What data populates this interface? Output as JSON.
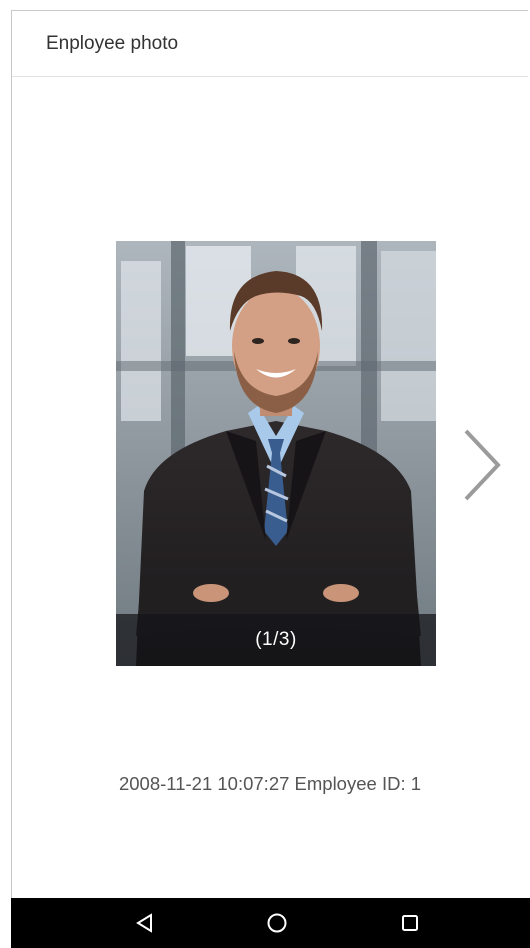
{
  "header": {
    "title": "Enployee photo"
  },
  "photo": {
    "counter": "(1/3)",
    "icon": "employee-portrait"
  },
  "navigation": {
    "next_icon": "chevron-right-icon"
  },
  "record": {
    "info": "2008-11-21 10:07:27 Employee ID: 1"
  },
  "system_nav": {
    "back_icon": "back-triangle-icon",
    "home_icon": "home-circle-icon",
    "recents_icon": "recents-square-icon"
  }
}
